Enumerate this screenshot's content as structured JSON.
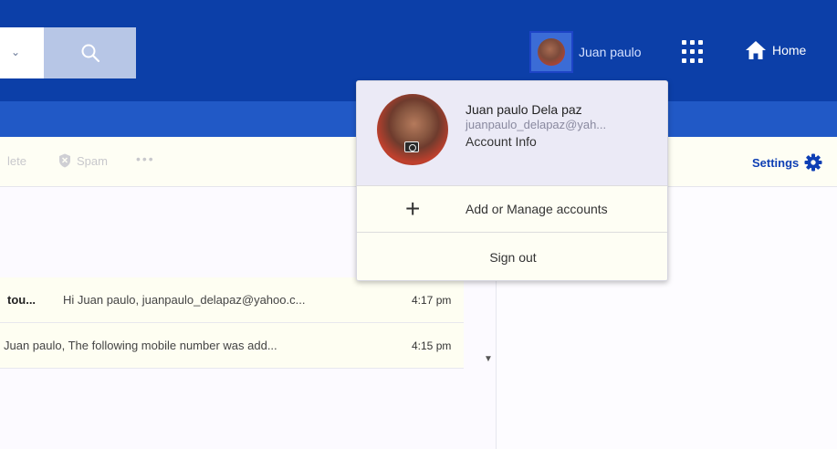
{
  "header": {
    "user_name": "Juan paulo",
    "home_label": "Home"
  },
  "toolbar": {
    "delete_label": "lete",
    "spam_label": "Spam",
    "more_label": "•••",
    "settings_label": "Settings"
  },
  "messages": [
    {
      "sender": "tou...",
      "snippet": "Hi Juan paulo, juanpaulo_delapaz@yahoo.c...",
      "time": "4:17 pm"
    },
    {
      "sender": "",
      "snippet": "Juan paulo, The following mobile number was add...",
      "time": "4:15 pm"
    }
  ],
  "account_menu": {
    "full_name": "Juan paulo Dela paz",
    "email": "juanpaulo_delapaz@yah...",
    "account_info_label": "Account Info",
    "add_manage_label": "Add or Manage accounts",
    "sign_out_label": "Sign out"
  },
  "colors": {
    "header_bg": "#0c3fa8",
    "header_band": "#2159c6",
    "accent": "#0e3fb4",
    "menu_head_bg": "#ebeaf6"
  },
  "icons": [
    "chevron-down-icon",
    "search-icon",
    "apps-grid-icon",
    "home-icon",
    "shield-icon",
    "gear-icon",
    "plus-icon",
    "camera-icon"
  ]
}
